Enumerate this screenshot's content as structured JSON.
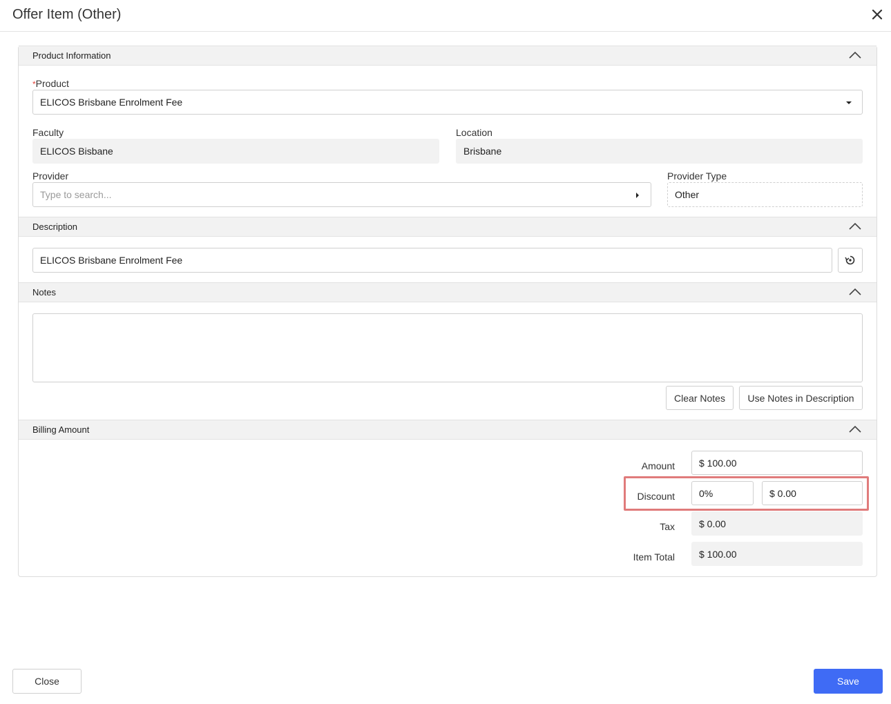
{
  "dialog": {
    "title": "Offer Item (Other)",
    "close_icon": "close-icon"
  },
  "sections": {
    "product_info": "Product Information",
    "description": "Description",
    "notes": "Notes",
    "billing": "Billing Amount"
  },
  "product": {
    "label": "Product",
    "required_mark": "*",
    "value": "ELICOS Brisbane Enrolment Fee"
  },
  "faculty": {
    "label": "Faculty",
    "value": "ELICOS Bisbane"
  },
  "location": {
    "label": "Location",
    "value": "Brisbane"
  },
  "provider": {
    "label": "Provider",
    "placeholder": "Type to search..."
  },
  "provider_type": {
    "label": "Provider Type",
    "value": "Other"
  },
  "description": {
    "value": "ELICOS Brisbane Enrolment Fee",
    "reset_icon": "reset-icon"
  },
  "notes": {
    "value": "",
    "clear_label": "Clear Notes",
    "use_label": "Use Notes in Description"
  },
  "billing": {
    "amount_label": "Amount",
    "amount_value": "$ 100.00",
    "discount_label": "Discount",
    "discount_percent": "0%",
    "discount_value": "$ 0.00",
    "tax_label": "Tax",
    "tax_value": "$ 0.00",
    "total_label": "Item Total",
    "total_value": "$ 100.00"
  },
  "footer": {
    "close_label": "Close",
    "save_label": "Save"
  },
  "colors": {
    "primary": "#3f6bf5",
    "highlight": "#e07b7b",
    "required": "#e0443b"
  }
}
